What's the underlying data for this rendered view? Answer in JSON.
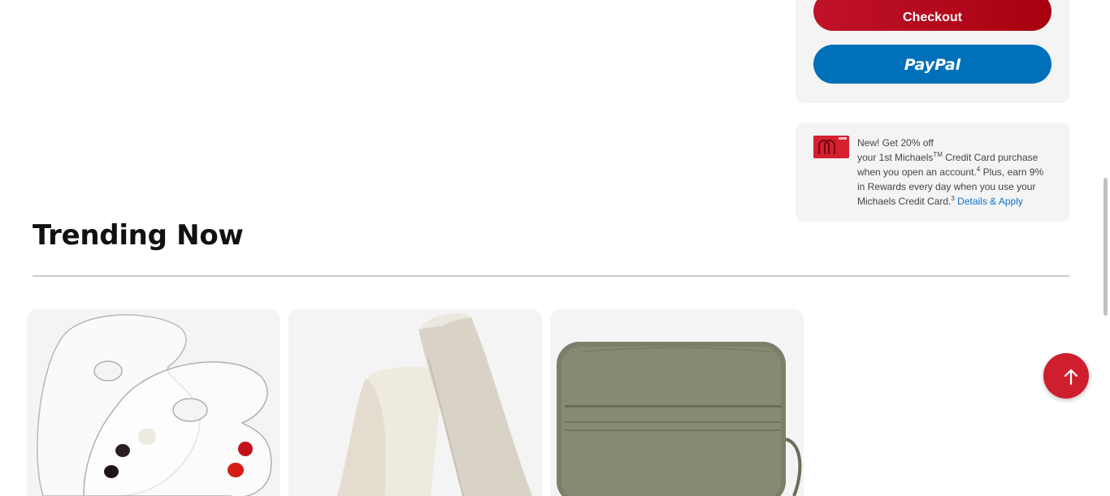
{
  "checkout": {
    "checkout_label": "Checkout",
    "paypal_label": "PayPal"
  },
  "promo": {
    "line1": "New! Get 20% off",
    "line2_a": "your 1st Michaels",
    "line2_tm": "TM",
    "line2_b": " Credit Card purchase",
    "line3_a": "when you open an account.",
    "line3_sup": "4",
    "line3_b": " Plus, earn 9%",
    "line4": "in Rewards every day when you use your",
    "line5_a": "Michaels Credit Card.",
    "line5_sup": "3",
    "link": "Details & Apply",
    "card_icon": "credit-card-image"
  },
  "trending": {
    "title": "Trending Now",
    "products": [
      {
        "name": "clear-palette-product",
        "image": "acrylic-palettes-with-paint"
      },
      {
        "name": "canvas-roll-product",
        "image": "rolled-canvas"
      },
      {
        "name": "brush-roll-product",
        "image": "green-canvas-brush-roll"
      }
    ]
  },
  "scroll_top": {
    "icon": "arrow-up-icon"
  },
  "colors": {
    "checkout_red": "#b70c1f",
    "paypal_blue": "#0070ba",
    "link_blue": "#0d72c9",
    "panel_gray": "#f4f4f4",
    "scroll_top_red": "#cf1f2e"
  }
}
